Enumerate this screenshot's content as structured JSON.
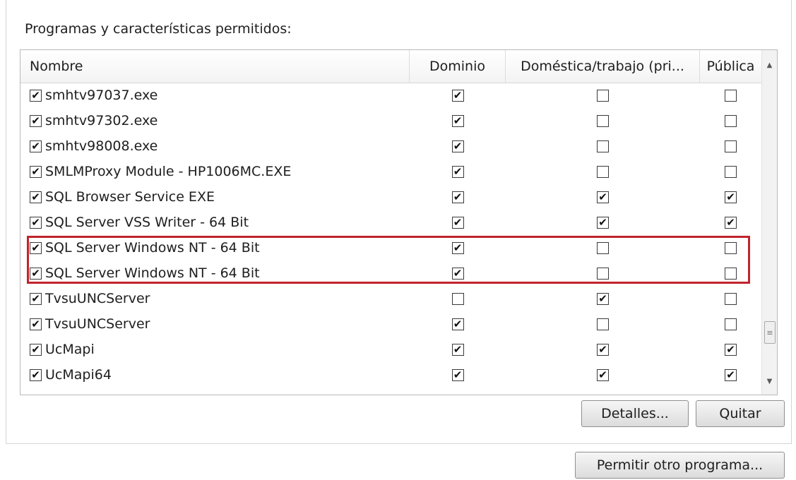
{
  "panel": {
    "title": "Programas y características permitidos:"
  },
  "columns": [
    "Nombre",
    "Dominio",
    "Doméstica/trabajo (pri...",
    "Pública"
  ],
  "rows": [
    {
      "name": "smhtv97037.exe",
      "enabled": true,
      "dominio": true,
      "domestica": false,
      "publica": false
    },
    {
      "name": "smhtv97302.exe",
      "enabled": true,
      "dominio": true,
      "domestica": false,
      "publica": false
    },
    {
      "name": "smhtv98008.exe",
      "enabled": true,
      "dominio": true,
      "domestica": false,
      "publica": false
    },
    {
      "name": "SMLMProxy Module - HP1006MC.EXE",
      "enabled": true,
      "dominio": true,
      "domestica": false,
      "publica": false
    },
    {
      "name": "SQL Browser Service EXE",
      "enabled": true,
      "dominio": true,
      "domestica": true,
      "publica": true
    },
    {
      "name": "SQL Server VSS Writer - 64 Bit",
      "enabled": true,
      "dominio": true,
      "domestica": true,
      "publica": true
    },
    {
      "name": "SQL Server Windows NT - 64 Bit",
      "enabled": true,
      "dominio": true,
      "domestica": false,
      "publica": false
    },
    {
      "name": "SQL Server Windows NT - 64 Bit",
      "enabled": true,
      "dominio": true,
      "domestica": false,
      "publica": false
    },
    {
      "name": "TvsuUNCServer",
      "enabled": true,
      "dominio": false,
      "domestica": true,
      "publica": false
    },
    {
      "name": "TvsuUNCServer",
      "enabled": true,
      "dominio": true,
      "domestica": false,
      "publica": false
    },
    {
      "name": "UcMapi",
      "enabled": true,
      "dominio": true,
      "domestica": true,
      "publica": true
    },
    {
      "name": "UcMapi64",
      "enabled": true,
      "dominio": true,
      "domestica": true,
      "publica": true
    }
  ],
  "buttons": {
    "details": "Detalles...",
    "remove": "Quitar",
    "allow_other": "Permitir otro programa..."
  },
  "icons": {
    "check": "✔",
    "scroll_up": "▲",
    "scroll_down": "▼",
    "thumb_grip": "≡"
  },
  "colors": {
    "highlight": "#c0242c"
  }
}
